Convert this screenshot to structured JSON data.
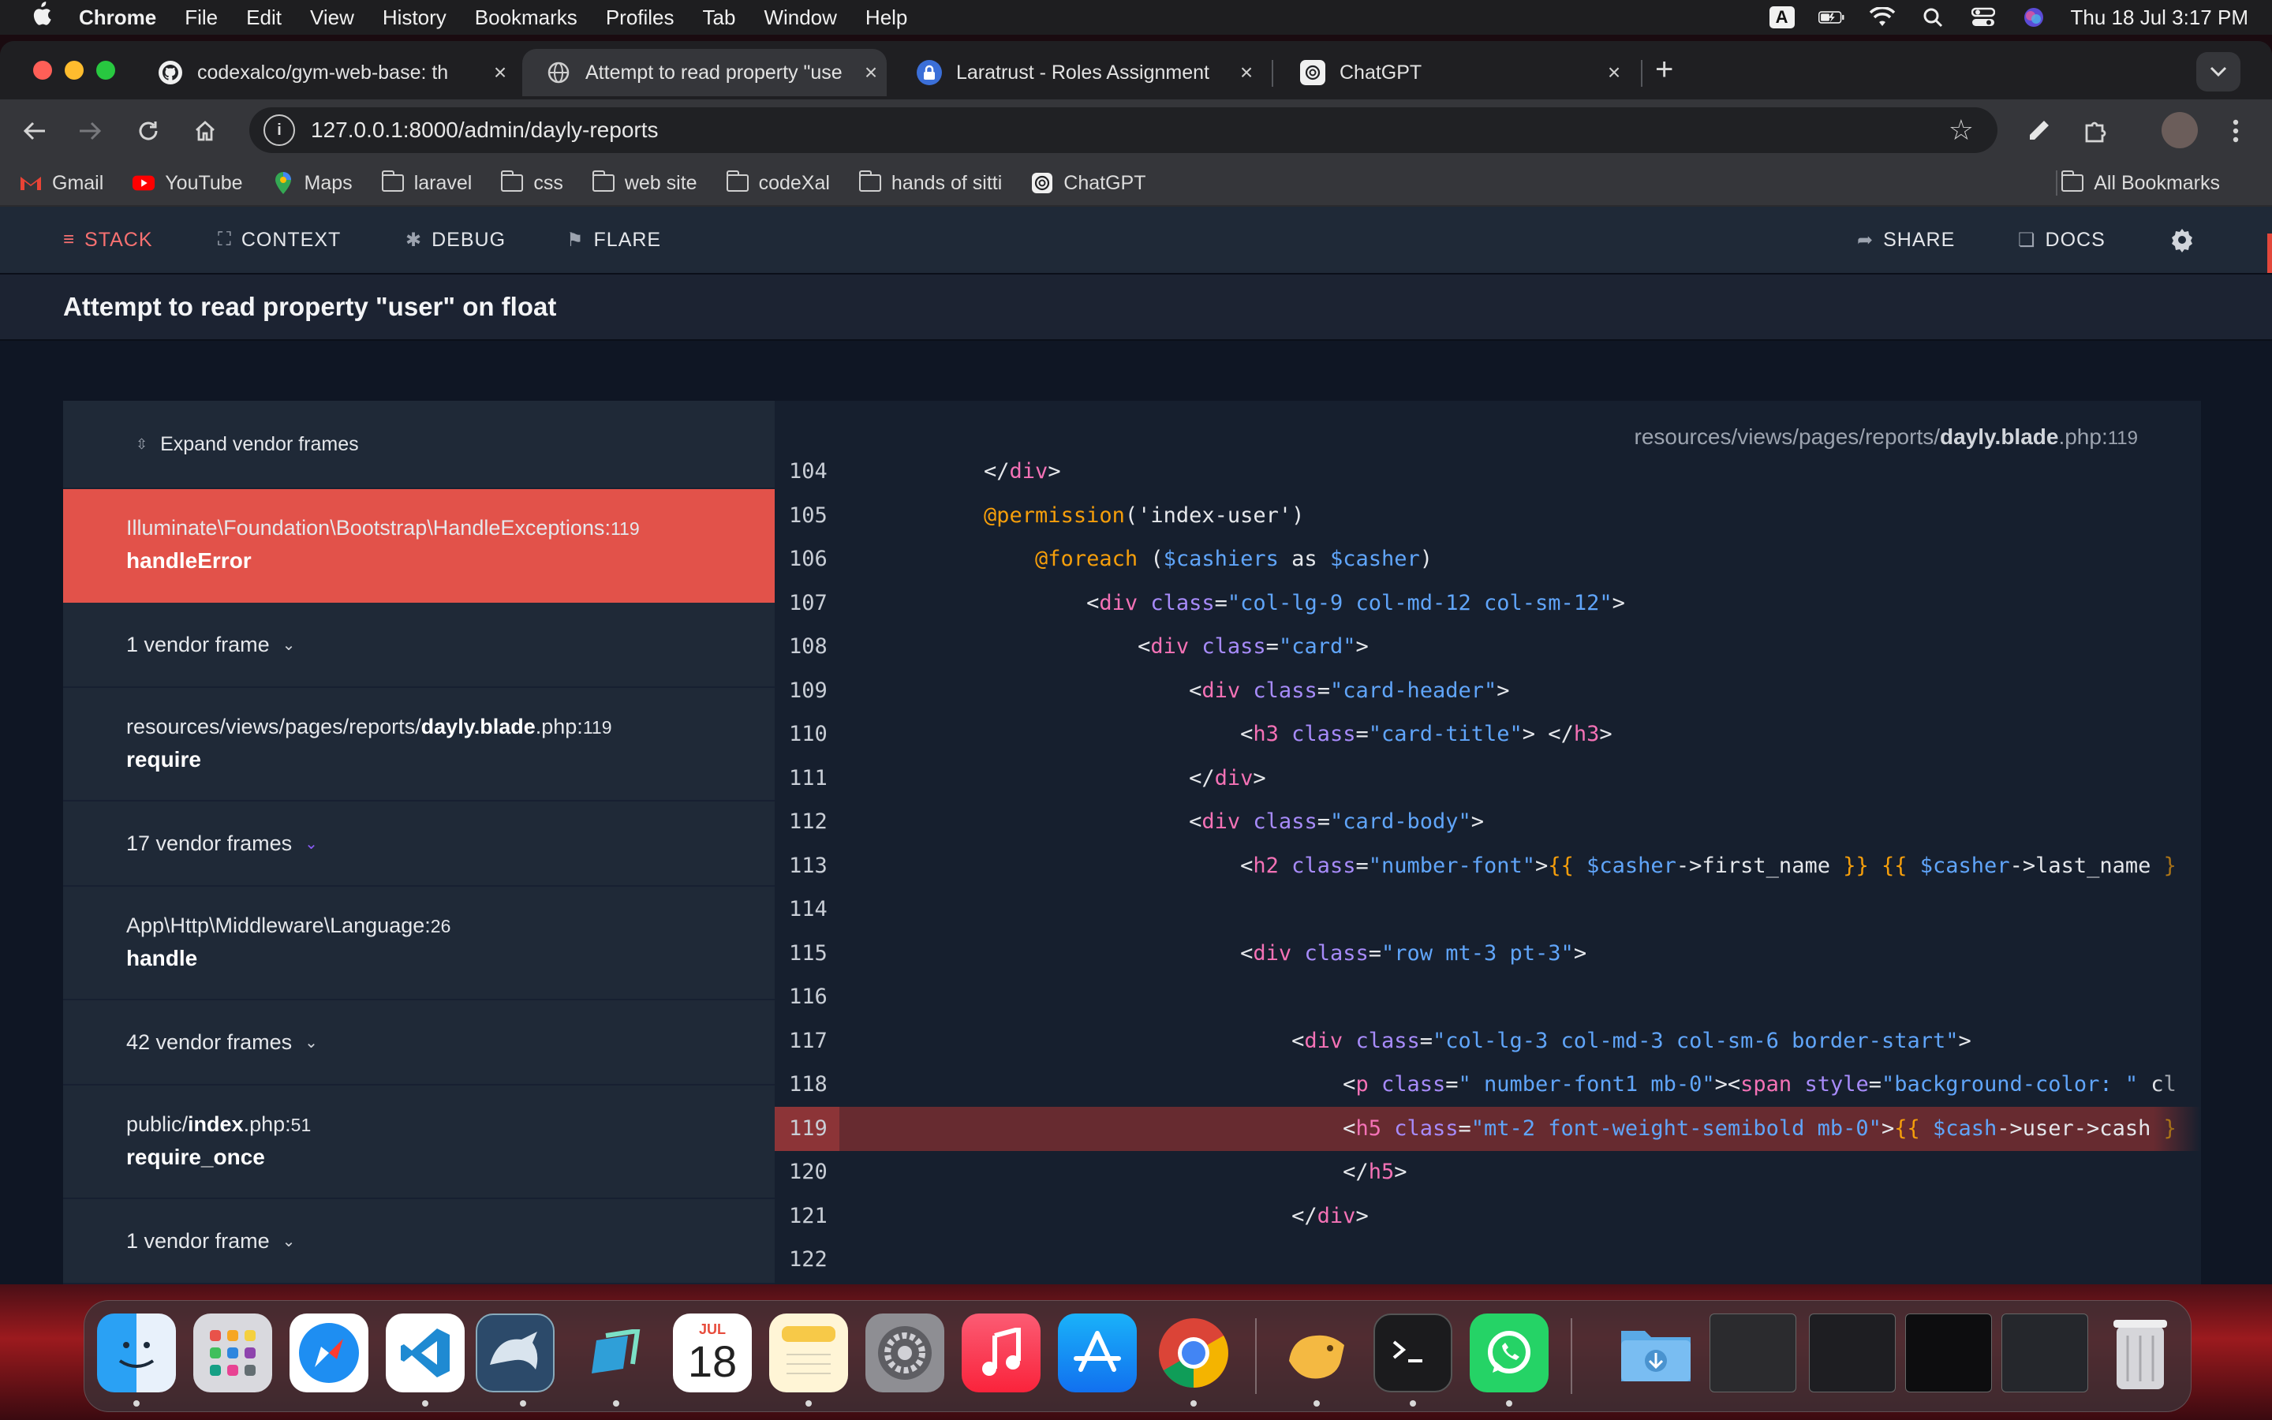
{
  "menubar": {
    "app": "Chrome",
    "items": [
      "File",
      "Edit",
      "View",
      "History",
      "Bookmarks",
      "Profiles",
      "Tab",
      "Window",
      "Help"
    ],
    "input_source": "A",
    "datetime": "Thu 18 Jul  3:17 PM"
  },
  "tabs": [
    {
      "title": "codexalco/gym-web-base: th",
      "icon": "github-icon"
    },
    {
      "title": "Attempt to read property \"use",
      "icon": "globe-icon"
    },
    {
      "title": "Laratrust - Roles Assignment",
      "icon": "lock-icon"
    },
    {
      "title": "ChatGPT",
      "icon": "chatgpt-icon"
    }
  ],
  "address": {
    "url": "127.0.0.1:8000/admin/dayly-reports"
  },
  "bookmarks": {
    "items": [
      {
        "label": "Gmail",
        "icon": "gmail-icon"
      },
      {
        "label": "YouTube",
        "icon": "youtube-icon"
      },
      {
        "label": "Maps",
        "icon": "maps-icon"
      },
      {
        "label": "laravel",
        "icon": "folder-icon"
      },
      {
        "label": "css",
        "icon": "folder-icon"
      },
      {
        "label": "web site",
        "icon": "folder-icon"
      },
      {
        "label": "codeXal",
        "icon": "folder-icon"
      },
      {
        "label": "hands of sitti",
        "icon": "folder-icon"
      },
      {
        "label": "ChatGPT",
        "icon": "chatgpt-icon"
      }
    ],
    "all": "All Bookmarks"
  },
  "ignition": {
    "nav": {
      "stack": "STACK",
      "context": "CONTEXT",
      "debug": "DEBUG",
      "flare": "FLARE",
      "share": "SHARE",
      "docs": "DOCS"
    },
    "error_title": "Attempt to read property \"user\" on float",
    "expand_vendor": "Expand vendor frames",
    "frames": [
      {
        "kind": "app",
        "active": true,
        "segments": [
          "Illuminate",
          "\\",
          "Foundation",
          "\\",
          "Bootstrap",
          "\\",
          "HandleExceptions"
        ],
        "bold": "",
        "line": "119",
        "fn": "handleError"
      },
      {
        "kind": "vendor",
        "label": "1 vendor frame"
      },
      {
        "kind": "app",
        "active": false,
        "prefix": "resources/views/pages/reports/",
        "bold": "dayly.blade",
        "suffix": ".php",
        "line": "119",
        "fn": "require"
      },
      {
        "kind": "vendor",
        "label": "17 vendor frames"
      },
      {
        "kind": "app",
        "active": false,
        "prefix": "App\\Http\\Middleware\\Language",
        "bold": "",
        "suffix": "",
        "line": "26",
        "fn": "handle"
      },
      {
        "kind": "vendor",
        "label": "42 vendor frames"
      },
      {
        "kind": "app",
        "active": false,
        "prefix": "public/",
        "bold": "index",
        "suffix": ".php",
        "line": "51",
        "fn": "require_once"
      },
      {
        "kind": "vendor",
        "label": "1 vendor frame"
      }
    ],
    "file_path": {
      "prefix": "resources/views/pages/reports/",
      "bold": "dayly.blade",
      "suffix": ".php",
      "line": "119"
    },
    "code": [
      {
        "n": "104",
        "text": "    </div>"
      },
      {
        "n": "105",
        "text": "    @permission('index-user')"
      },
      {
        "n": "106",
        "text": "        @foreach ($cashiers as $casher)"
      },
      {
        "n": "107",
        "text": "            <div class=\"col-lg-9 col-md-12 col-sm-12\">"
      },
      {
        "n": "108",
        "text": "                <div class=\"card\">"
      },
      {
        "n": "109",
        "text": "                    <div class=\"card-header\">"
      },
      {
        "n": "110",
        "text": "                        <h3 class=\"card-title\"> </h3>"
      },
      {
        "n": "111",
        "text": "                    </div>"
      },
      {
        "n": "112",
        "text": "                    <div class=\"card-body\">"
      },
      {
        "n": "113",
        "text": "                        <h2 class=\"number-font\">{{ $casher->first_name }} {{ $casher->last_name }"
      },
      {
        "n": "114",
        "text": ""
      },
      {
        "n": "115",
        "text": "                        <div class=\"row mt-3 pt-3\">"
      },
      {
        "n": "116",
        "text": ""
      },
      {
        "n": "117",
        "text": "                            <div class=\"col-lg-3 col-md-3 col-sm-6 border-start\">"
      },
      {
        "n": "118",
        "text": "                                <p class=\" number-font1 mb-0\"><span style=\"background-color: \" cl"
      },
      {
        "n": "119",
        "text": "                                <h5 class=\"mt-2 font-weight-semibold mb-0\">{{ $cash->user->cash }"
      },
      {
        "n": "120",
        "text": "                                </h5>"
      },
      {
        "n": "121",
        "text": "                            </div>"
      },
      {
        "n": "122",
        "text": ""
      }
    ],
    "highlight_line": "119"
  },
  "dock": {
    "calendar_month": "JUL",
    "calendar_day": "18",
    "apps": [
      "finder-icon",
      "launchpad-icon",
      "safari-icon",
      "vscode-icon",
      "mysql-workbench-icon",
      "screen-icon",
      "calendar-icon",
      "notes-icon",
      "system-settings-icon",
      "music-icon",
      "app-store-icon",
      "chrome-icon",
      "tableplus-icon",
      "terminal-icon",
      "whatsapp-icon",
      "downloads-folder-icon",
      "window-thumb-icon",
      "window-thumb-icon",
      "window-thumb-icon",
      "window-thumb-icon",
      "trash-icon"
    ]
  },
  "colors": {
    "accent_red": "#e2524a",
    "ignition_bg": "#161f2e",
    "highlight_row": "#672b30"
  }
}
